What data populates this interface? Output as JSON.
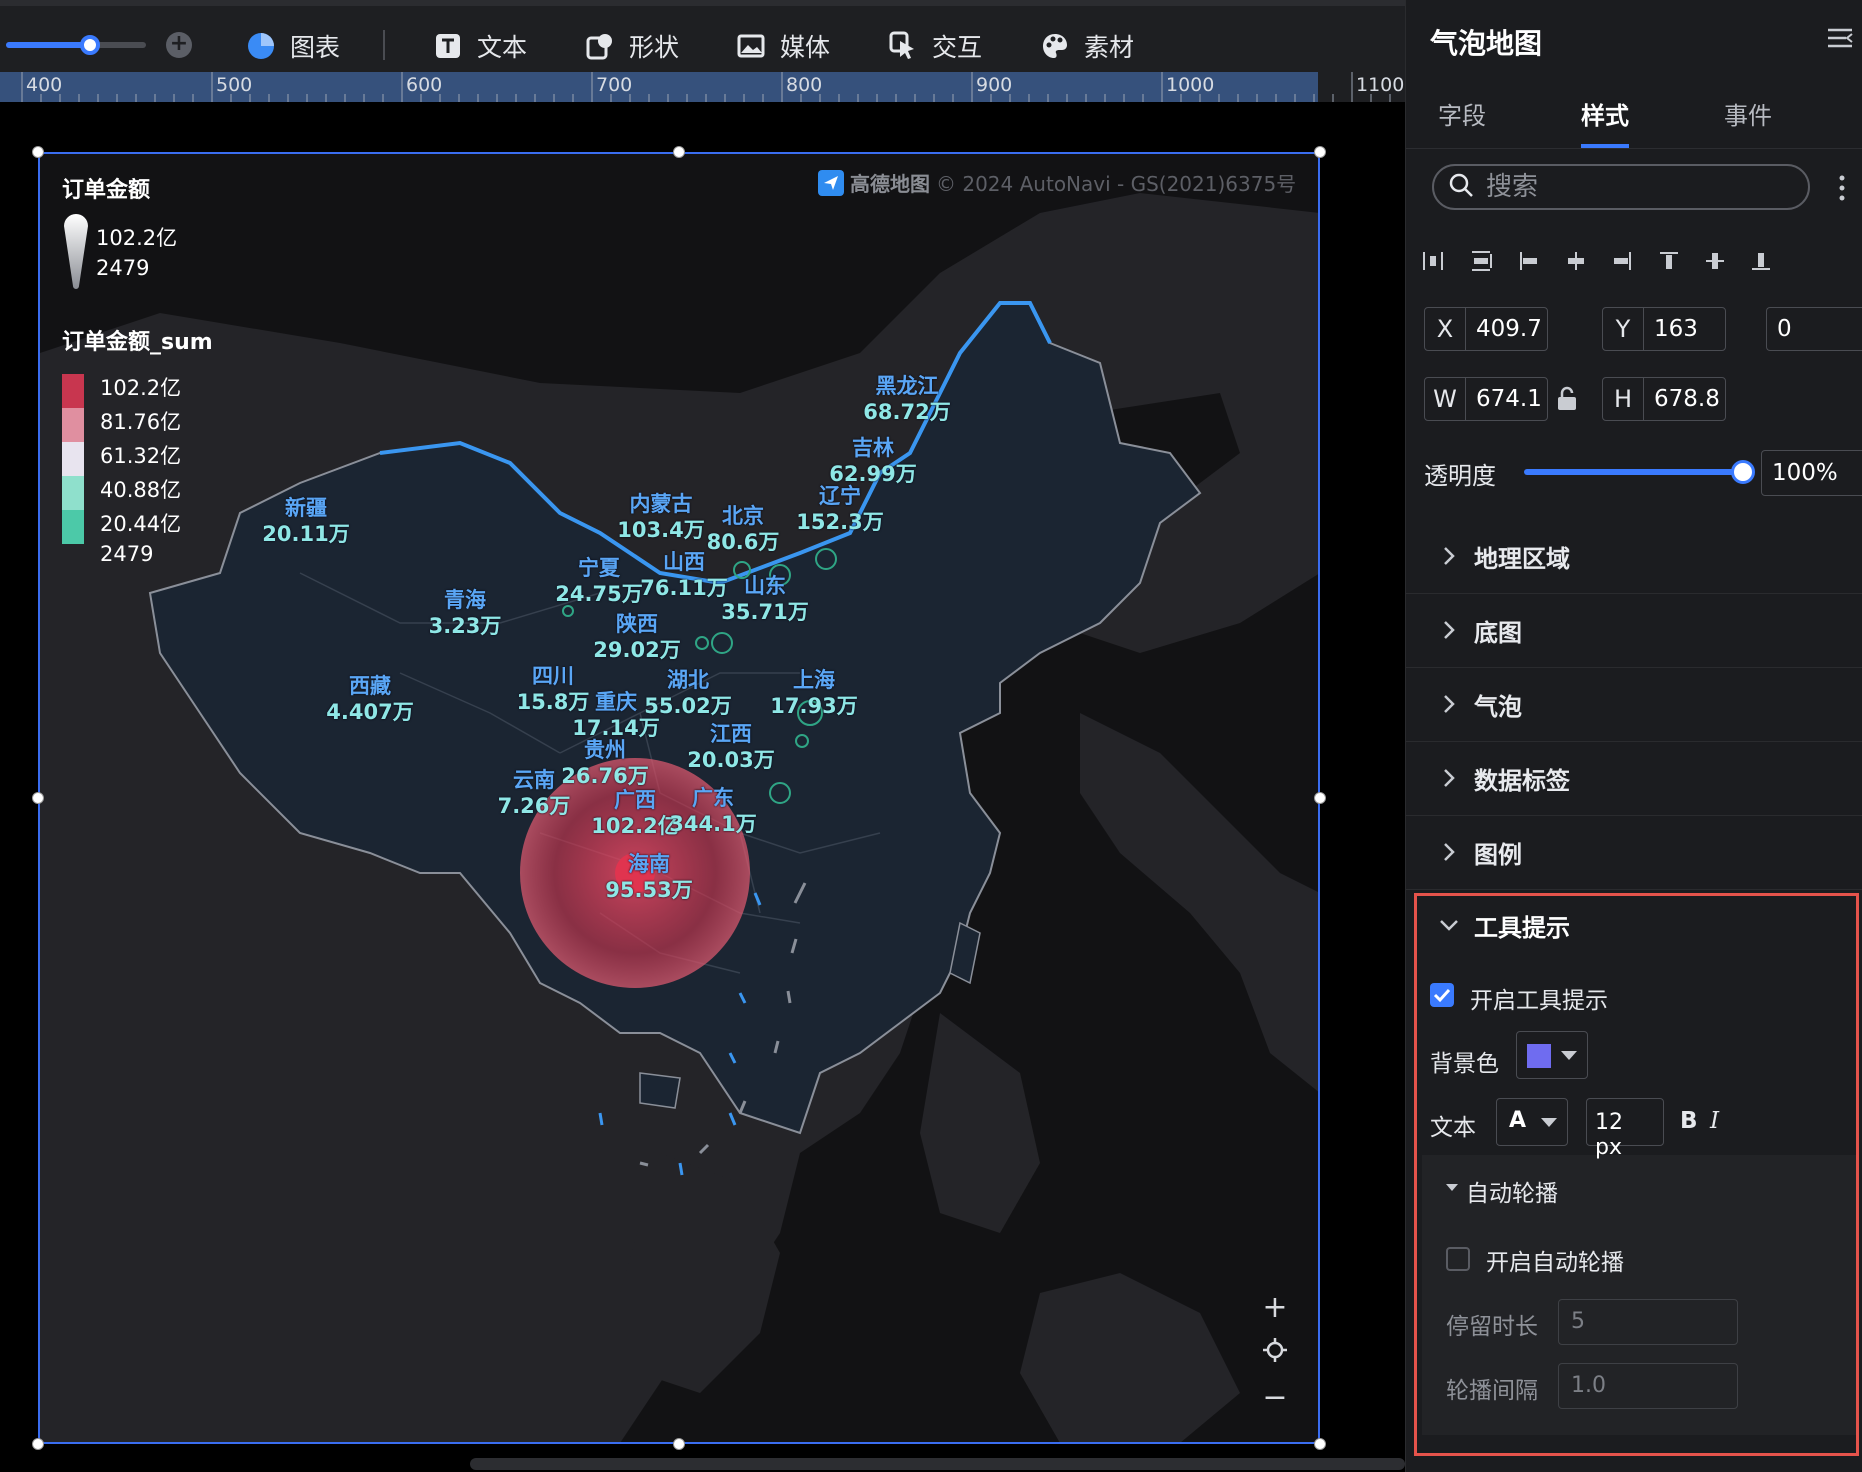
{
  "toolbar": {
    "items": [
      {
        "label": "图表",
        "icon": "pie-chart-icon"
      },
      {
        "label": "文本",
        "icon": "text-icon"
      },
      {
        "label": "形状",
        "icon": "shape-icon"
      },
      {
        "label": "媒体",
        "icon": "image-icon"
      },
      {
        "label": "交互",
        "icon": "pointer-icon"
      },
      {
        "label": "素材",
        "icon": "palette-icon"
      }
    ]
  },
  "ruler": {
    "ticks": [
      "400",
      "500",
      "600",
      "700",
      "800",
      "900",
      "1000",
      "1100"
    ]
  },
  "map": {
    "attribution": "© 2024 AutoNavi - GS(2021)6375号",
    "provider": "高德地图",
    "legend": {
      "size_title": "订单金额",
      "size_max": "102.2亿",
      "size_min": "2479",
      "color_title": "订单金额_sum",
      "color_steps": [
        {
          "label": "102.2亿",
          "color": "#c8364f"
        },
        {
          "label": "81.76亿",
          "color": "#e08fa0"
        },
        {
          "label": "61.32亿",
          "color": "#e8e4ef"
        },
        {
          "label": "40.88亿",
          "color": "#8fe0cc"
        },
        {
          "label": "20.44亿",
          "color": "#4cc9a8"
        },
        {
          "label": "2479",
          "color": null
        }
      ]
    },
    "regions": [
      {
        "name": "黑龙江",
        "value": "68.72万"
      },
      {
        "name": "吉林",
        "value": "62.99万"
      },
      {
        "name": "辽宁",
        "value": "152.3万"
      },
      {
        "name": "北京",
        "value": "80.6万"
      },
      {
        "name": "内蒙古",
        "value": "103.4万"
      },
      {
        "name": "新疆",
        "value": "20.11万"
      },
      {
        "name": "宁夏",
        "value": "24.75万"
      },
      {
        "name": "山西",
        "value": "76.11万"
      },
      {
        "name": "山东",
        "value": "35.71万"
      },
      {
        "name": "青海",
        "value": "3.23万"
      },
      {
        "name": "陕西",
        "value": "29.02万"
      },
      {
        "name": "西藏",
        "value": "4.407万"
      },
      {
        "name": "四川",
        "value": "15.8万"
      },
      {
        "name": "湖北",
        "value": "55.02万"
      },
      {
        "name": "重庆",
        "value": "17.14万"
      },
      {
        "name": "上海",
        "value": "17.93万"
      },
      {
        "name": "贵州",
        "value": "26.76万"
      },
      {
        "name": "江西",
        "value": "20.03万"
      },
      {
        "name": "云南",
        "value": "7.26万"
      },
      {
        "name": "广西",
        "value": "102.2亿"
      },
      {
        "name": "广东",
        "value": "344.1万"
      },
      {
        "name": "海南",
        "value": "95.53万"
      }
    ],
    "controls": {
      "zoom_in": "+",
      "zoom_out": "−"
    }
  },
  "panel": {
    "title": "气泡地图",
    "tabs": [
      "字段",
      "样式",
      "事件"
    ],
    "active_tab": "样式",
    "search_placeholder": "搜索",
    "x_label": "X",
    "x": "409.7",
    "y_label": "Y",
    "y": "163",
    "rotation": "0",
    "w_label": "W",
    "w": "674.1",
    "h_label": "H",
    "h": "678.8",
    "opacity_label": "透明度",
    "opacity": "100%",
    "sections": [
      "地理区域",
      "底图",
      "气泡",
      "数据标签",
      "图例"
    ],
    "tooltip": {
      "title": "工具提示",
      "enable_label": "开启工具提示",
      "enabled": true,
      "bg_label": "背景色",
      "bg_color": "#6f6cf0",
      "text_label": "文本",
      "font_icon": "A",
      "font_size": "12 px",
      "bold": "B",
      "italic": "I",
      "autoplay_title": "自动轮播",
      "autoplay_enable_label": "开启自动轮播",
      "autoplay_enabled": false,
      "dwell_label": "停留时长",
      "dwell_value": "5",
      "interval_label": "轮播间隔",
      "interval_value": "1.0"
    }
  }
}
